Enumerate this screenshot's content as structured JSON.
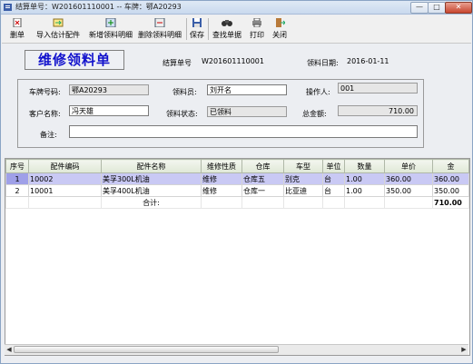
{
  "window": {
    "title": "结算单号：W201601110001 -- 车牌：鄂A20293",
    "min_label": "—",
    "max_label": "□",
    "close_label": "✕"
  },
  "toolbar": {
    "items": [
      {
        "label": "删单",
        "icon": "delete-doc-icon"
      },
      {
        "label": "导入估计配件",
        "icon": "import-icon"
      },
      {
        "label": "新增领料明细",
        "icon": "add-detail-icon"
      },
      {
        "label": "删除领料明细",
        "icon": "remove-detail-icon"
      },
      {
        "label": "保存",
        "icon": "save-icon"
      },
      {
        "label": "查找单据",
        "icon": "binoculars-icon"
      },
      {
        "label": "打印",
        "icon": "printer-icon"
      },
      {
        "label": "关闭",
        "icon": "exit-icon"
      }
    ]
  },
  "header": {
    "title": "维修领料单",
    "settle_no_label": "结算单号",
    "settle_no_value": "W201601110001",
    "pick_date_label": "领料日期:",
    "pick_date_value": "2016-01-11"
  },
  "form": {
    "plate_label": "车牌号码:",
    "plate_value": "鄂A20293",
    "picker_label": "领料员:",
    "picker_value": "刘开名",
    "operator_label": "操作人:",
    "operator_value": "001",
    "customer_label": "客户名称:",
    "customer_value": "冯天雄",
    "status_label": "领料状态:",
    "status_value": "已领料",
    "total_label": "总金额:",
    "total_value": "710.00",
    "remark_label": "备注:",
    "remark_value": ""
  },
  "grid": {
    "columns": [
      "序号",
      "配件编码",
      "配件名称",
      "维修性质",
      "仓库",
      "车型",
      "单位",
      "数量",
      "单价",
      "金"
    ],
    "rows": [
      {
        "no": "1",
        "code": "10002",
        "name": "美孚300L机油",
        "nature": "维修",
        "warehouse": "仓库五",
        "model": "别克",
        "unit": "台",
        "qty": "1.00",
        "price": "360.00",
        "amount": "360.00"
      },
      {
        "no": "2",
        "code": "10001",
        "name": "美孚400L机油",
        "nature": "维修",
        "warehouse": "仓库一",
        "model": "比亚迪",
        "unit": "台",
        "qty": "1.00",
        "price": "350.00",
        "amount": "350.00"
      }
    ],
    "summary_label": "合计:",
    "summary_amount": "710.00"
  },
  "scroll": {
    "left": "◀",
    "right": "▶"
  }
}
